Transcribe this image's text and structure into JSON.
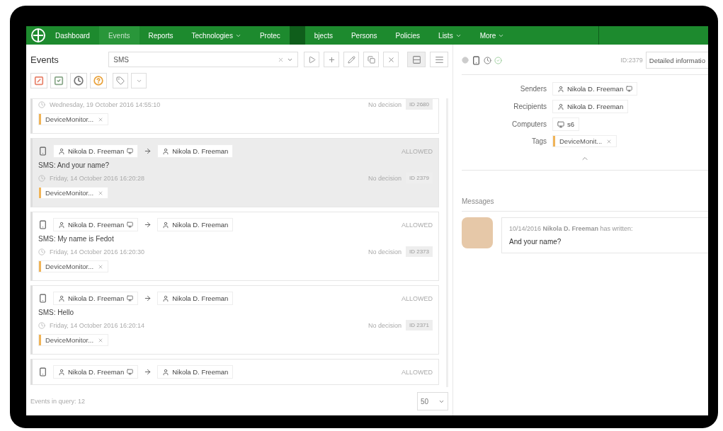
{
  "nav": {
    "items": [
      {
        "label": "Dashboard",
        "selected": false,
        "dropdown": false
      },
      {
        "label": "Events",
        "selected": true,
        "dropdown": false
      },
      {
        "label": "Reports",
        "selected": false,
        "dropdown": false
      },
      {
        "label": "Technologies",
        "selected": false,
        "dropdown": true
      },
      {
        "label": "Protec",
        "selected": false,
        "dropdown": false
      },
      {
        "label": "bjects",
        "selected": false,
        "dropdown": false
      },
      {
        "label": "Persons",
        "selected": false,
        "dropdown": false
      },
      {
        "label": "Policies",
        "selected": false,
        "dropdown": false
      },
      {
        "label": "Lists",
        "selected": false,
        "dropdown": true
      },
      {
        "label": "More",
        "selected": false,
        "dropdown": true
      }
    ]
  },
  "events": {
    "title": "Events",
    "query": "SMS",
    "views": [
      {
        "kind": "cards",
        "selected": true
      },
      {
        "kind": "list",
        "selected": false
      }
    ],
    "filters": [
      {
        "kind": "blocked",
        "color": "#e8836b"
      },
      {
        "kind": "allowed",
        "color": "#8aa88a"
      },
      {
        "kind": "pending",
        "color": "#777777"
      },
      {
        "kind": "unknown",
        "color": "#e9a23b"
      }
    ],
    "cards": [
      {
        "partial": true,
        "selected": false,
        "date": "Wednesday, 19 October 2016 14:55:10",
        "decision": "No decision",
        "id": "ID 2680",
        "tag": "DeviceMonitor...",
        "color": "#f0b458"
      },
      {
        "partial": false,
        "selected": true,
        "sender": "Nikola D. Freeman",
        "recipient": "Nikola D. Freeman",
        "status": "ALLOWED",
        "message": "SMS: And your name?",
        "date": "Friday, 14 October 2016 16:20:28",
        "decision": "No decision",
        "id": "ID 2379",
        "tag": "DeviceMonitor...",
        "color": "#f0b458"
      },
      {
        "partial": false,
        "selected": false,
        "sender": "Nikola D. Freeman",
        "recipient": "Nikola D. Freeman",
        "status": "ALLOWED",
        "message": "SMS: My name is Fedot",
        "date": "Friday, 14 October 2016 16:20:30",
        "decision": "No decision",
        "id": "ID 2373",
        "tag": "DeviceMonitor...",
        "color": "#f0b458"
      },
      {
        "partial": false,
        "selected": false,
        "sender": "Nikola D. Freeman",
        "recipient": "Nikola D. Freeman",
        "status": "ALLOWED",
        "message": "SMS: Hello",
        "date": "Friday, 14 October 2016 16:20:14",
        "decision": "No decision",
        "id": "ID 2371",
        "tag": "DeviceMonitor...",
        "color": "#f0b458"
      },
      {
        "partial": false,
        "selected": false,
        "sender": "Nikola D. Freeman",
        "recipient": "Nikola D. Freeman",
        "status": "ALLOWED"
      }
    ],
    "count": "Events in query: 12",
    "page_size": "50"
  },
  "detail": {
    "id": "ID:2379",
    "button": "Detailed informatio",
    "fields": [
      {
        "label": "Senders",
        "kind": "person",
        "value": "Nikola D. Freeman"
      },
      {
        "label": "Recipients",
        "kind": "person",
        "value": "Nikola D. Freeman"
      },
      {
        "label": "Computers",
        "kind": "computer",
        "value": "s6"
      },
      {
        "label": "Tags",
        "kind": "tag",
        "value": "DeviceMonit...",
        "color": "#f0b458"
      }
    ],
    "messages_title": "Messages",
    "message": {
      "meta": "10/14/2016 **Nikola D. Freeman** has written:",
      "text": "And your name?"
    }
  }
}
